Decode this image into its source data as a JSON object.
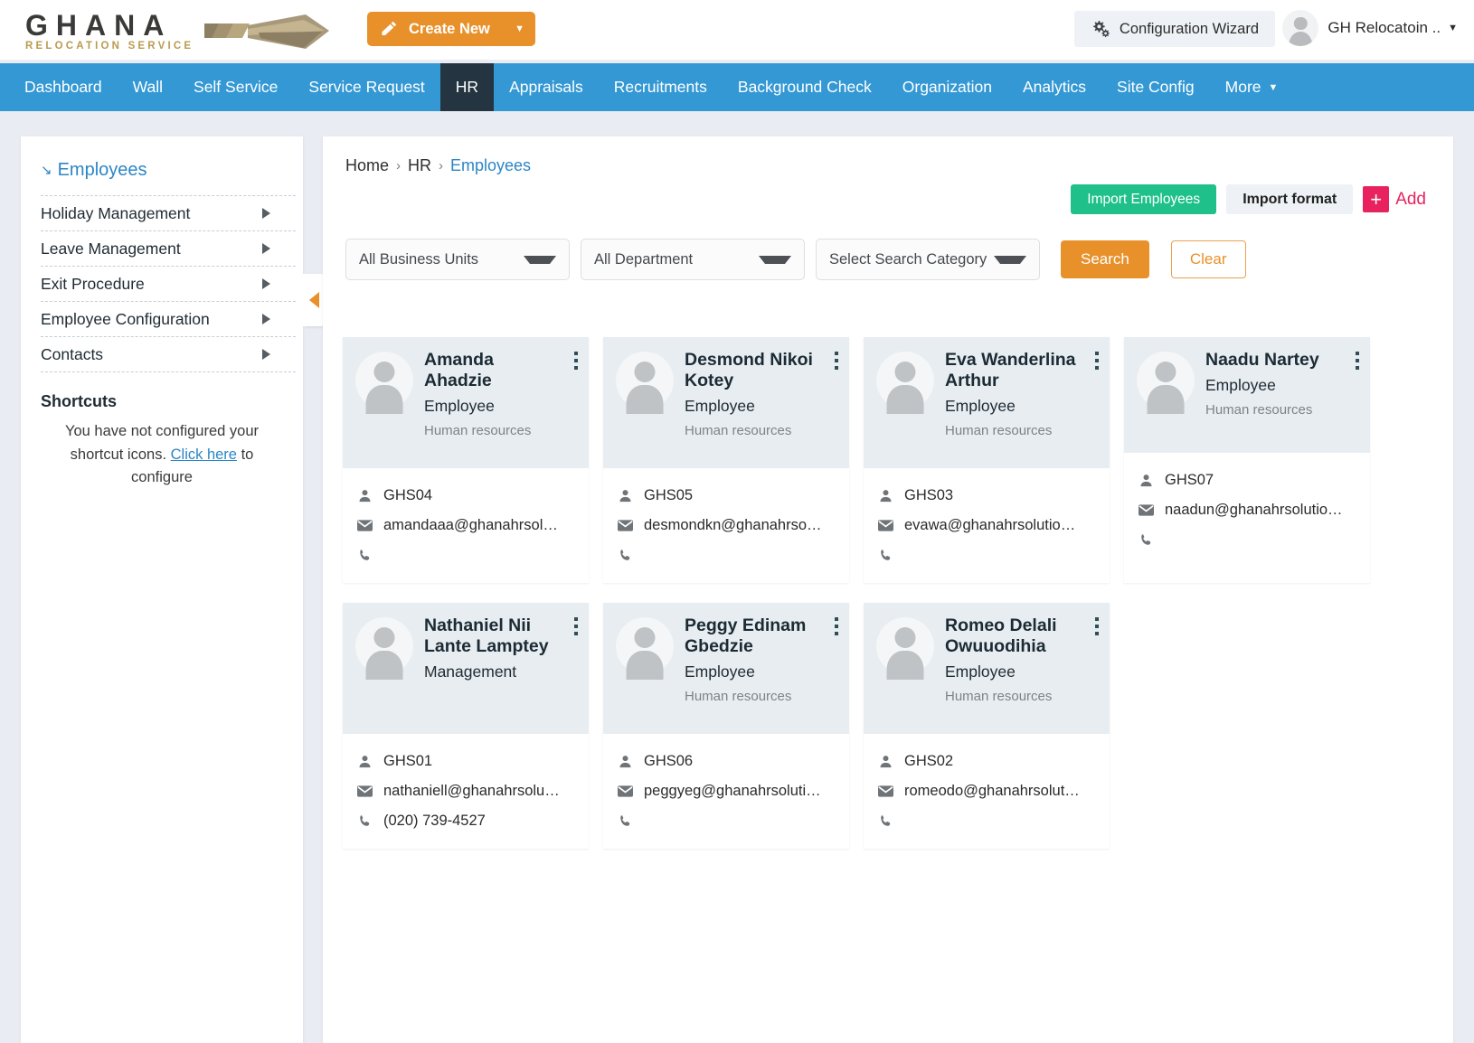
{
  "header": {
    "logo_text": "GHANA",
    "logo_subtext": "RELOCATION SERVICE",
    "create_new_label": "Create New",
    "create_new_caret": "▼",
    "config_wizard_label": "Configuration Wizard",
    "user_name": "GH Relocatoin ..",
    "user_caret": "▼"
  },
  "nav": {
    "items": [
      {
        "label": "Dashboard",
        "active": false
      },
      {
        "label": "Wall",
        "active": false
      },
      {
        "label": "Self Service",
        "active": false
      },
      {
        "label": "Service Request",
        "active": false
      },
      {
        "label": "HR",
        "active": true
      },
      {
        "label": "Appraisals",
        "active": false
      },
      {
        "label": "Recruitments",
        "active": false
      },
      {
        "label": "Background Check",
        "active": false
      },
      {
        "label": "Organization",
        "active": false
      },
      {
        "label": "Analytics",
        "active": false
      },
      {
        "label": "Site Config",
        "active": false
      }
    ],
    "more_label": "More",
    "more_caret": "▼"
  },
  "sidebar": {
    "header_label": "Employees",
    "header_icon": "↘",
    "items": [
      {
        "label": "Holiday Management"
      },
      {
        "label": "Leave Management"
      },
      {
        "label": "Exit Procedure"
      },
      {
        "label": "Employee Configuration"
      },
      {
        "label": "Contacts"
      }
    ],
    "shortcuts_title": "Shortcuts",
    "shortcuts_text_before": "You have not configured your shortcut icons. ",
    "shortcuts_link": "Click here",
    "shortcuts_text_after": " to configure"
  },
  "breadcrumb": {
    "home": "Home",
    "sep": "›",
    "section": "HR",
    "current": "Employees"
  },
  "toolbar": {
    "import_employees_label": "Import Employees",
    "import_format_label": "Import format",
    "add_plus": "+",
    "add_label": "Add"
  },
  "filters": {
    "business_unit": "All Business Units",
    "department": "All Department",
    "search_category": "Select Search Category",
    "search_label": "Search",
    "clear_label": "Clear"
  },
  "colors": {
    "nav_blue": "#3398d4",
    "nav_active": "#243441",
    "orange": "#e8912a",
    "green": "#1fc08a",
    "pink": "#e8225f",
    "link_blue": "#2b86c6"
  },
  "employees": [
    {
      "name": "Amanda Ahadzie",
      "role": "Employee",
      "department": "Human resources",
      "id": "GHS04",
      "email": "amandaaa@ghanahrsol…",
      "phone": ""
    },
    {
      "name": "Desmond Nikoi Kotey",
      "role": "Employee",
      "department": "Human resources",
      "id": "GHS05",
      "email": "desmondkn@ghanahrso…",
      "phone": ""
    },
    {
      "name": "Eva Wanderlina Arthur",
      "role": "Employee",
      "department": "Human resources",
      "id": "GHS03",
      "email": "evawa@ghanahrsolutio…",
      "phone": ""
    },
    {
      "name": "Naadu Nartey",
      "role": "Employee",
      "department": "Human resources",
      "id": "GHS07",
      "email": "naadun@ghanahrsolutio…",
      "phone": ""
    },
    {
      "name": "Nathaniel Nii Lante Lamptey",
      "role": "Management",
      "department": "",
      "id": "GHS01",
      "email": "nathaniell@ghanahrsolu…",
      "phone": "(020) 739-4527"
    },
    {
      "name": "Peggy Edinam Gbedzie",
      "role": "Employee",
      "department": "Human resources",
      "id": "GHS06",
      "email": "peggyeg@ghanahrsoluti…",
      "phone": ""
    },
    {
      "name": "Romeo Delali Owuuodihia",
      "role": "Employee",
      "department": "Human resources",
      "id": "GHS02",
      "email": "romeodo@ghanahrsolut…",
      "phone": ""
    }
  ]
}
